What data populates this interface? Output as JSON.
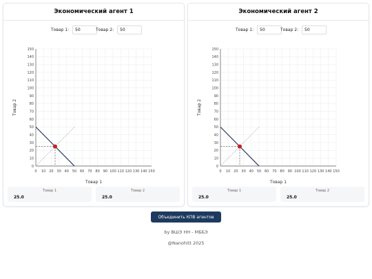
{
  "agents": [
    {
      "title": "Экономический агент 1",
      "input1_label": "Товар 1:",
      "input1_value": "50",
      "input2_label": "Товар 2:",
      "input2_value": "50",
      "result1_label": "Товар 1",
      "result1_value": "25.0",
      "result2_label": "Товар 2",
      "result2_value": "25.0"
    },
    {
      "title": "Экономический агент 2",
      "input1_label": "Товар 1:",
      "input1_value": "50",
      "input2_label": "Товар 2:",
      "input2_value": "50",
      "result1_label": "Товар 1",
      "result1_value": "25.0",
      "result2_label": "Товар 2",
      "result2_value": "25.0"
    }
  ],
  "chart_data": [
    {
      "type": "line",
      "xlabel": "Товар 1",
      "ylabel": "Товар 2",
      "xlim": [
        0,
        150
      ],
      "ylim": [
        0,
        150
      ],
      "ticks": [
        0,
        10,
        20,
        30,
        40,
        50,
        60,
        70,
        80,
        90,
        100,
        110,
        120,
        130,
        140,
        150
      ],
      "grid": true,
      "series": [
        {
          "role": "budget-line",
          "color": "#3b4a6b",
          "points": [
            [
              0,
              50
            ],
            [
              50,
              0
            ]
          ]
        },
        {
          "role": "diagonal",
          "color": "#9aa0a6",
          "points": [
            [
              0,
              0
            ],
            [
              50,
              50
            ]
          ]
        }
      ],
      "optimum": {
        "x": 25,
        "y": 25,
        "color": "#cc1f1f"
      }
    },
    {
      "type": "line",
      "xlabel": "Товар 1",
      "ylabel": "Товар 2",
      "xlim": [
        0,
        150
      ],
      "ylim": [
        0,
        150
      ],
      "ticks": [
        0,
        10,
        20,
        30,
        40,
        50,
        60,
        70,
        80,
        90,
        100,
        110,
        120,
        130,
        140,
        150
      ],
      "grid": true,
      "series": [
        {
          "role": "budget-line",
          "color": "#3b4a6b",
          "points": [
            [
              0,
              50
            ],
            [
              50,
              0
            ]
          ]
        },
        {
          "role": "diagonal",
          "color": "#9aa0a6",
          "points": [
            [
              0,
              0
            ],
            [
              50,
              50
            ]
          ]
        }
      ],
      "optimum": {
        "x": 25,
        "y": 25,
        "color": "#cc1f1f"
      }
    }
  ],
  "merge_button": "Объединить КПВ агентов",
  "footer": {
    "line1": "by ВШЭ НН - МББЭ",
    "line2": "@Nanohitt 2025"
  },
  "colors": {
    "accent": "#1e3a5f",
    "point": "#cc1f1f"
  }
}
